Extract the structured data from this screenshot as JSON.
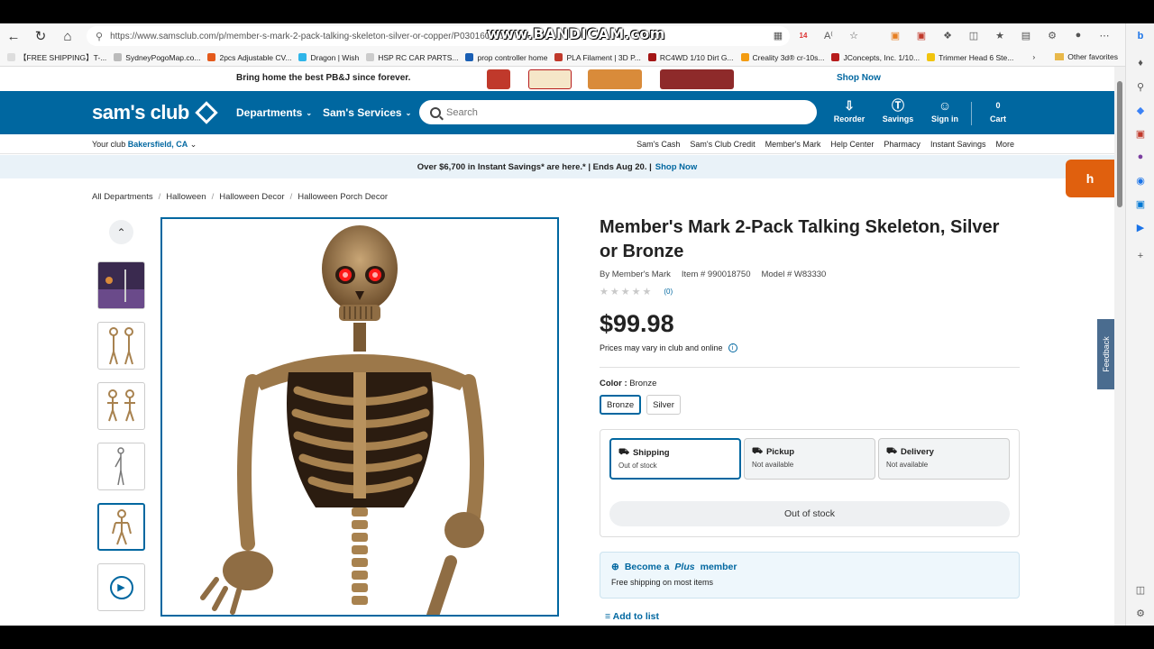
{
  "browser": {
    "url": "https://www.samsclub.com/p/member-s-mark-2-pack-talking-skeleton-silver-or-copper/P030160541",
    "watermark": "www.BANDICAM.com",
    "tab_count_badge": "14",
    "bookmarks": [
      {
        "label": "【FREE SHIPPING】T-...",
        "color": "#c00"
      },
      {
        "label": "SydneyPogoMap.co...",
        "color": "#888"
      },
      {
        "label": "2pcs Adjustable CV...",
        "color": "#e45a1c"
      },
      {
        "label": "Dragon | Wish",
        "color": "#2fb5e9"
      },
      {
        "label": "HSP RC CAR PARTS...",
        "color": "#333"
      },
      {
        "label": "prop controller home",
        "color": "#1a5fb4"
      },
      {
        "label": "PLA Filament | 3D P...",
        "color": "#c0392b"
      },
      {
        "label": "RC4WD 1/10 Dirt G...",
        "color": "#a31515"
      },
      {
        "label": "Creality 3d® cr-10s...",
        "color": "#f39c12"
      },
      {
        "label": "JConcepts, Inc. 1/10...",
        "color": "#b71c1c"
      },
      {
        "label": "Trimmer Head 6 Ste...",
        "color": "#f1c40f"
      }
    ],
    "other_favorites": "Other favorites"
  },
  "promo_top": {
    "text": "Bring home the best PB&J since forever.",
    "shop_now": "Shop Now"
  },
  "header": {
    "logo": "sam's club",
    "departments": "Departments",
    "services": "Sam's Services",
    "search_placeholder": "Search",
    "reorder": "Reorder",
    "savings": "Savings",
    "signin": "Sign in",
    "cart": "Cart",
    "cart_count": "0"
  },
  "subnav": {
    "your_club_label": "Your club",
    "club_name": "Bakersfield, CA",
    "links": [
      "Sam's Cash",
      "Sam's Club Credit",
      "Member's Mark",
      "Help Center",
      "Pharmacy",
      "Instant Savings",
      "More"
    ]
  },
  "instant_banner": {
    "text": "Over $6,700 in Instant Savings* are here.* | Ends Aug 20. |",
    "link": "Shop Now"
  },
  "breadcrumb": [
    "All Departments",
    "Halloween",
    "Halloween Decor",
    "Halloween Porch Decor"
  ],
  "product": {
    "title": "Member's Mark 2-Pack Talking Skeleton, Silver or Bronze",
    "brand": "By Member's Mark",
    "item": "Item # 990018750",
    "model": "Model # W83330",
    "rating_count": "(0)",
    "price": "$99.98",
    "price_note": "Prices may vary in club and online",
    "color_label": "Color :",
    "color_value": "Bronze",
    "swatches": [
      "Bronze",
      "Silver"
    ],
    "fulfillment": [
      {
        "name": "Shipping",
        "status": "Out of stock"
      },
      {
        "name": "Pickup",
        "status": "Not available"
      },
      {
        "name": "Delivery",
        "status": "Not available"
      }
    ],
    "out_of_stock_btn": "Out of stock",
    "plus_prefix": "Become a",
    "plus_word": "Plus",
    "plus_suffix": "member",
    "plus_sub": "Free shipping on most items",
    "add_to_list": "Add to list"
  },
  "feedback": "Feedback",
  "colors": {
    "brand_blue": "#0067a0",
    "orange": "#e0600e",
    "bronze": "#a8824f"
  }
}
